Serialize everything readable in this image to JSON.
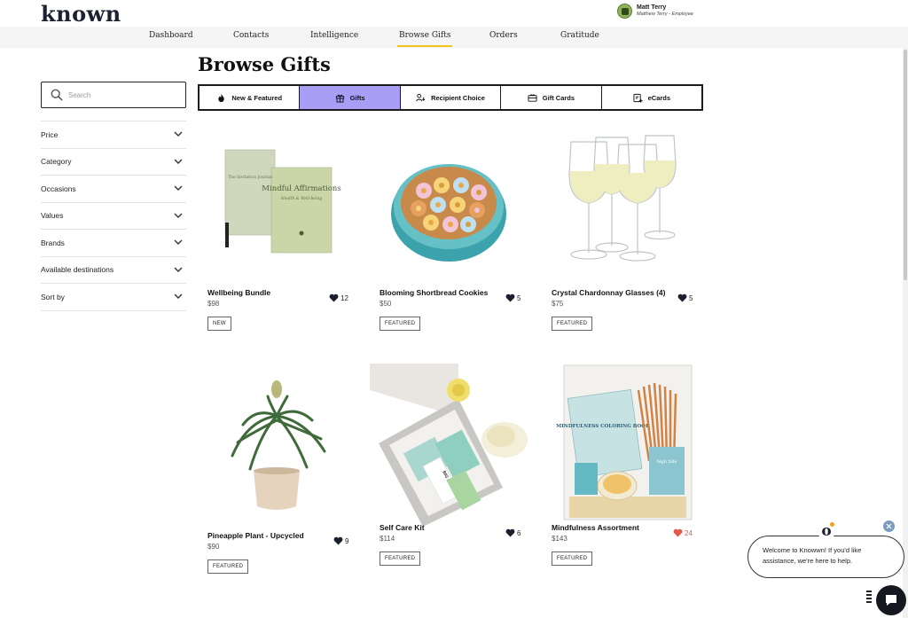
{
  "header": {
    "logo": "known",
    "user_name": "Matt Terry",
    "user_role": "Matthew Terry - Employee"
  },
  "nav": {
    "items": [
      "Dashboard",
      "Contacts",
      "Intelligence",
      "Browse Gifts",
      "Orders",
      "Gratitude"
    ],
    "active": "Browse Gifts"
  },
  "search": {
    "placeholder": "Search",
    "value": ""
  },
  "filters": [
    "Price",
    "Category",
    "Occasions",
    "Values",
    "Brands",
    "Available destinations",
    "Sort by"
  ],
  "page_title": "Browse Gifts",
  "tabs": [
    {
      "label": "New & Featured",
      "icon": "flame-icon"
    },
    {
      "label": "Gifts",
      "icon": "gift-icon"
    },
    {
      "label": "Recipient Choice",
      "icon": "recipient-icon"
    },
    {
      "label": "Gift Cards",
      "icon": "gift-card-icon"
    },
    {
      "label": "eCards",
      "icon": "ecard-icon"
    }
  ],
  "active_tab": "Gifts",
  "products": [
    {
      "name": "Wellbeing Bundle",
      "price": "$98",
      "likes": "12",
      "badge": "NEW",
      "liked": false
    },
    {
      "name": "Blooming Shortbread Cookies",
      "price": "$50",
      "likes": "5",
      "badge": "FEATURED",
      "liked": false
    },
    {
      "name": "Crystal Chardonnay Glasses (4)",
      "price": "$75",
      "likes": "5",
      "badge": "FEATURED",
      "liked": false
    },
    {
      "name": "Pineapple Plant - Upcycled",
      "price": "$90",
      "likes": "9",
      "badge": "FEATURED",
      "liked": false
    },
    {
      "name": "Self Care Kit",
      "price": "$114",
      "likes": "6",
      "badge": "FEATURED",
      "liked": false
    },
    {
      "name": "Mindfulness Assortment",
      "price": "$143",
      "likes": "24",
      "badge": "FEATURED",
      "liked": true
    }
  ],
  "product_images": {
    "book1_title": "The Invitation Journal",
    "book2_title": "Mindful Affirmations",
    "book2_sub": "Health & Well-being",
    "coloring_book": "MINDFULNESS COLORING BOOK",
    "tea": "BIG HEART TEA",
    "tin": "high tide"
  },
  "chat": {
    "message": "Welcome to Knowwn! If you'd like assistance, we're here to help.",
    "logo_letter": "o"
  },
  "colors": {
    "accent_tab": "#a99ef5",
    "nav_underline": "#f0c419",
    "like_active": "#e05a4a",
    "like_default": "#1a1f2e"
  }
}
